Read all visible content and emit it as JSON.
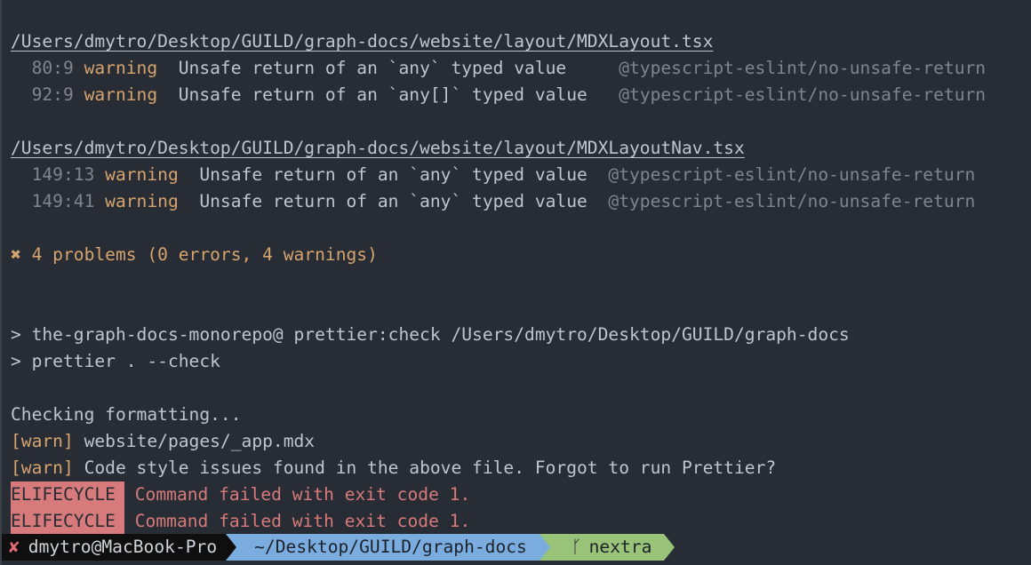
{
  "file1": {
    "path": "/Users/dmytro/Desktop/GUILD/graph-docs/website/layout/MDXLayout.tsx",
    "rows": [
      {
        "loc": "  80:9 ",
        "level": "warning",
        "message": "Unsafe return of an `any` typed value   ",
        "rule": "@typescript-eslint/no-unsafe-return"
      },
      {
        "loc": "  92:9 ",
        "level": "warning",
        "message": "Unsafe return of an `any[]` typed value ",
        "rule": "@typescript-eslint/no-unsafe-return"
      }
    ]
  },
  "file2": {
    "path": "/Users/dmytro/Desktop/GUILD/graph-docs/website/layout/MDXLayoutNav.tsx",
    "rows": [
      {
        "loc": "  149:13 ",
        "level": "warning",
        "message": "Unsafe return of an `any` typed value ",
        "rule": "@typescript-eslint/no-unsafe-return"
      },
      {
        "loc": "  149:41 ",
        "level": "warning",
        "message": "Unsafe return of an `any` typed value ",
        "rule": "@typescript-eslint/no-unsafe-return"
      }
    ]
  },
  "summary": "✖ 4 problems (0 errors, 4 warnings)",
  "script_lines": [
    "> the-graph-docs-monorepo@ prettier:check /Users/dmytro/Desktop/GUILD/graph-docs",
    "> prettier . --check"
  ],
  "checking": "Checking formatting...",
  "warn_lines": [
    {
      "tag": "[warn]",
      "text": " website/pages/_app.mdx"
    },
    {
      "tag": "[warn]",
      "text": " Code style issues found in the above file. Forgot to run Prettier?"
    }
  ],
  "failures": [
    {
      "badge": "ELIFECYCLE",
      "text": " Command failed with exit code 1."
    },
    {
      "badge": "ELIFECYCLE",
      "text": " Command failed with exit code 1."
    }
  ],
  "prompt": {
    "status_icon": "✘",
    "user_host": "dmytro@MacBook-Pro",
    "cwd": "~/Desktop/GUILD/graph-docs",
    "branch_icon": "ᚴ",
    "branch": "nextra"
  },
  "colors": {
    "background": "#282c34",
    "warning": "#d5a46f",
    "error": "#d77a7b",
    "dir_segment": "#7aacdf",
    "git_segment": "#98c379"
  }
}
